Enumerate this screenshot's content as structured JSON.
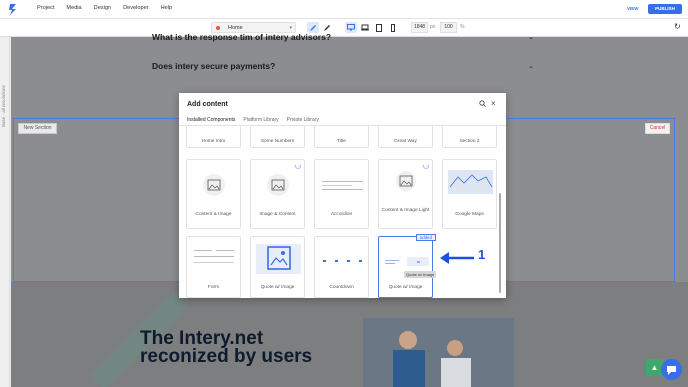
{
  "topbar": {
    "menu": [
      "Project",
      "Media",
      "Design",
      "Developer",
      "Help"
    ],
    "view_label": "VIEW",
    "publish_label": "PUBLISH",
    "page_select": "Home",
    "width_value": "1848",
    "width_unit": "px",
    "zoom_value": "100",
    "zoom_unit": "%"
  },
  "sidebar": {
    "label": "Base - all resolutions"
  },
  "canvas": {
    "faq": [
      "What is the response tim of intery advisors?",
      "Does intery secure payments?"
    ],
    "new_section_label": "New Section",
    "cancel_label": "Cancel",
    "hero_text": "The Intery.net reconized by users"
  },
  "modal": {
    "title": "Add content",
    "tabs": [
      "Installed Components",
      "Platform Library",
      "Private Library"
    ],
    "active_tab": 0,
    "row1": [
      "Home Intro",
      "Some Numbers",
      "Title",
      "Great Way",
      "Section 2"
    ],
    "row2": [
      "Content & Image",
      "Image & Content",
      "Accordion",
      "Content & Image Light",
      "Google Maps"
    ],
    "row3": [
      "Form",
      "Quote w/ Image",
      "Countdown",
      "Quote w/ Image"
    ],
    "badge": "added",
    "tooltip": "Quote w/ Image",
    "annotation_number": "1"
  },
  "colors": {
    "accent": "#3a6ee8",
    "cancel": "#d13333",
    "green": "#3fa86d"
  }
}
